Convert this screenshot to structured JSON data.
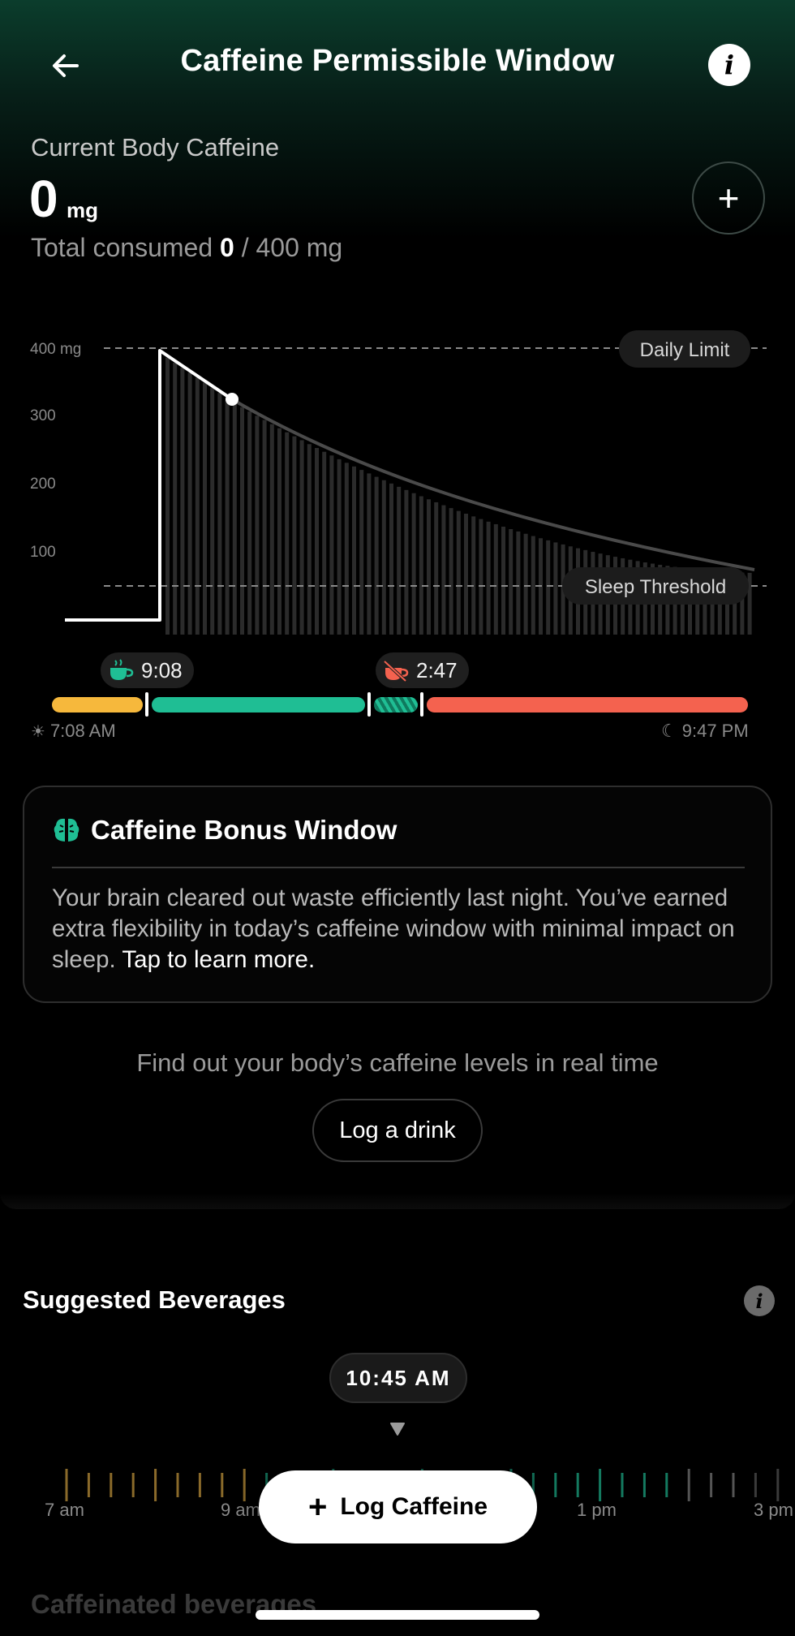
{
  "header": {
    "title": "Caffeine Permissible Window",
    "back_icon": "arrow-left-icon",
    "info_icon": "info-icon",
    "info_glyph": "i"
  },
  "current": {
    "label": "Current Body Caffeine",
    "value": "0",
    "unit": "mg",
    "total_prefix": "Total consumed",
    "total_value": "0",
    "total_suffix": "/ 400 mg",
    "add_glyph": "+"
  },
  "chart": {
    "y_ticks": [
      "400 mg",
      "300",
      "200",
      "100"
    ],
    "daily_limit_label": "Daily Limit",
    "sleep_threshold_label": "Sleep Threshold"
  },
  "timeline": {
    "chip_start": "9:08",
    "chip_end": "2:47",
    "start_time": "7:08 AM",
    "end_time": "9:47 PM",
    "colors": {
      "morning": "#f6b83c",
      "window": "#1fbe94",
      "cutoff": "#f4624f"
    }
  },
  "bonus": {
    "title": "Caffeine Bonus Window",
    "text": "Your brain cleared out waste efficiently last night. You’ve earned extra flexibility in today’s caffeine window with minimal impact on sleep.",
    "link": "Tap to learn more."
  },
  "realtime": {
    "text": "Find out your body’s caffeine levels in real time",
    "button": "Log a drink"
  },
  "suggested": {
    "title": "Suggested Beverages",
    "selected_time": "10:45 AM",
    "ruler_labels": [
      "7 am",
      "9 am",
      "1 pm",
      "3 pm"
    ],
    "log_button": "Log Caffeine",
    "next_section": "Caffeinated beverages"
  }
}
